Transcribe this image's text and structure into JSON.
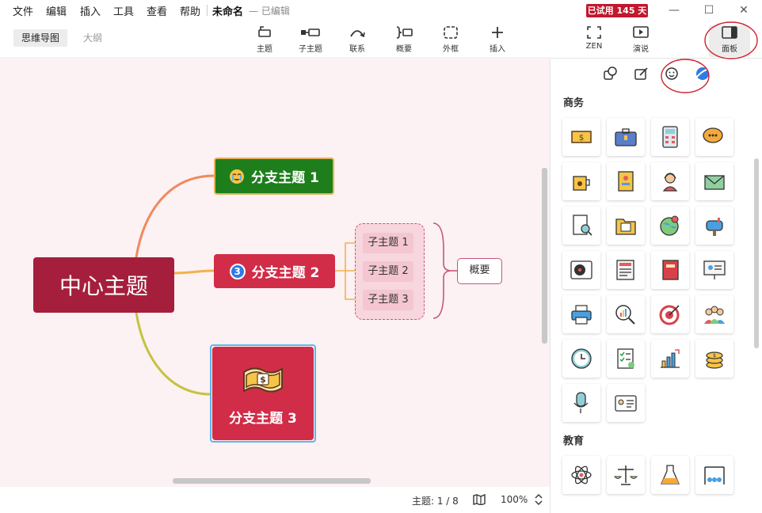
{
  "menu": [
    "文件",
    "编辑",
    "插入",
    "工具",
    "查看",
    "帮助"
  ],
  "doc_title": "未命名",
  "doc_status": "— 已编辑",
  "trial_badge": "已试用 145 天",
  "view_tabs": [
    "思维导图",
    "大纲"
  ],
  "tools": {
    "topic": "主题",
    "subtopic": "子主题",
    "relationship": "联系",
    "summary": "概要",
    "boundary": "外框",
    "insert": "插入",
    "zen": "ZEN",
    "presentation": "演说",
    "panel": "面板"
  },
  "map": {
    "central": "中心主题",
    "branch1": "分支主题 1",
    "branch2": "分支主题 2",
    "branch2_badge": "3",
    "branch3": "分支主题 3",
    "subtopics": [
      "子主题 1",
      "子主题 2",
      "子主题 3"
    ],
    "summary": "概要"
  },
  "statusbar": {
    "topics": "主题: 1 / 8",
    "zoom": "100%"
  },
  "panel": {
    "section_business": "商务",
    "section_education": "教育",
    "business_stickers": [
      "money-icon",
      "briefcase-icon",
      "calculator-icon",
      "chat-bubbles-icon",
      "coffee-cup-icon",
      "contacts-book-icon",
      "support-agent-icon",
      "mail-icon",
      "document-magnify-icon",
      "folder-icon",
      "globe-pin-icon",
      "mailbox-icon",
      "record-player-icon",
      "newspaper-icon",
      "red-book-icon",
      "presentation-board-icon",
      "printer-icon",
      "chart-magnifier-icon",
      "target-icon",
      "team-icon",
      "clock-icon",
      "checklist-icon",
      "bar-chart-icon",
      "coins-icon",
      "microphone-icon",
      "id-card-icon"
    ],
    "education_stickers": [
      "atom-icon",
      "scales-icon",
      "lab-flask-icon",
      "newton-cradle-icon"
    ]
  },
  "colors": {
    "central": "#a51f3c",
    "branch1": "#1e7e1c",
    "branch2": "#d12c48",
    "branch3": "#d12c48",
    "canvas": "#fcf1f3",
    "highlight_circle": "#d0202e"
  }
}
